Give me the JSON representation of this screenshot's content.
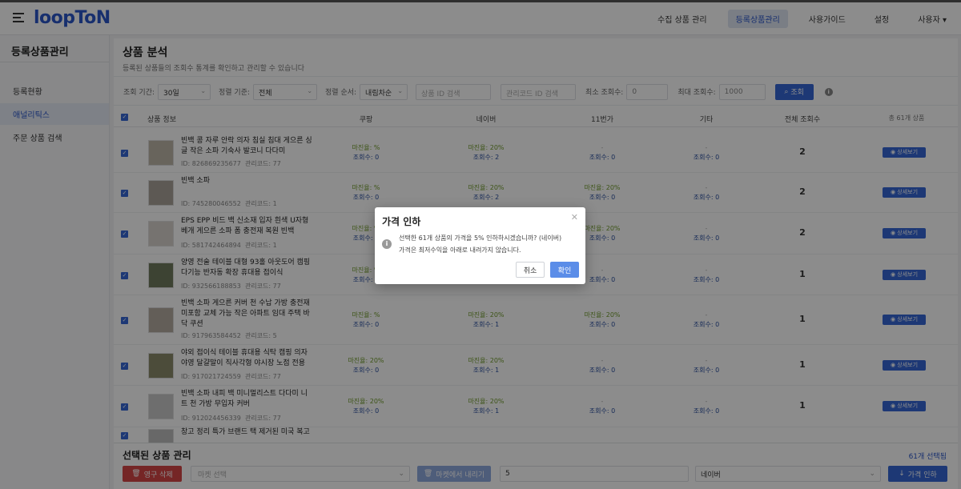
{
  "topbar": {
    "logo": "loopToN",
    "nav": [
      "수집 상품 관리",
      "등록상품관리",
      "사용가이드",
      "설정",
      "사용자 ▾"
    ]
  },
  "sidebar": {
    "title": "등록상품관리",
    "items": [
      "등록현황",
      "애널리틱스",
      "주문 상품 검색"
    ]
  },
  "header": {
    "title": "상품 분석",
    "subtitle": "등록된 상품들의 조회수 통계를 확인하고 관리할 수 있습니다"
  },
  "filters": {
    "period_label": "조회 기간:",
    "period_value": "30일",
    "sort_base_label": "정렬 기준:",
    "sort_base_value": "전체",
    "sort_order_label": "정렬 순서:",
    "sort_order_value": "내림차순",
    "product_id_placeholder": "상품 ID 검색",
    "manage_code_placeholder": "관리코드 ID 검색",
    "min_views_label": "최소 조회수:",
    "min_views_value": "0",
    "max_views_label": "최대 조회수:",
    "max_views_value": "1000",
    "search_label": "조회"
  },
  "table": {
    "headers": [
      "상품 정보",
      "쿠팡",
      "네이버",
      "11번가",
      "기타",
      "전체 조회수",
      "총 61개 상품"
    ],
    "rows": [
      {
        "name": "빈백 콩 자루 안락 의자 침실 침대 게으른 싱글 작은 소파 기숙사 발코니 다다미",
        "id": "ID: 826869235677",
        "code": "관리코드: 77",
        "coupang": {
          "margin": "마진율: %",
          "views": "조회수: 0"
        },
        "naver": {
          "margin": "마진율: 20%",
          "views": "조회수: 2"
        },
        "st11": {
          "margin": "-",
          "views": "조회수: 0"
        },
        "etc": {
          "margin": "-",
          "views": "조회수: 0"
        },
        "total": "2",
        "detail": "상세보기"
      },
      {
        "name": "빈백 소파",
        "id": "ID: 745280046552",
        "code": "관리코드: 1",
        "coupang": {
          "margin": "마진율: %",
          "views": "조회수: 0"
        },
        "naver": {
          "margin": "마진율: 20%",
          "views": "조회수: 2"
        },
        "st11": {
          "margin": "마진율: 20%",
          "views": "조회수: 0"
        },
        "etc": {
          "margin": "-",
          "views": "조회수: 0"
        },
        "total": "2",
        "detail": "상세보기"
      },
      {
        "name": "EPS EPP 비드 백 신소재 입자 흰색 U자형 베개 게으른 소파 폼 충전재 복원 빈백",
        "id": "ID: 581742464894",
        "code": "관리코드: 1",
        "coupang": {
          "margin": "마진율: %",
          "views": "조회수: 0"
        },
        "naver": {
          "margin": "마진율: 20%",
          "views": "조회수: 2"
        },
        "st11": {
          "margin": "마진율: 20%",
          "views": "조회수: 0"
        },
        "etc": {
          "margin": "-",
          "views": "조회수: 0"
        },
        "total": "2",
        "detail": "상세보기"
      },
      {
        "name": "양영 전술 테이블 대형 93홀 아웃도어 캠핑 다기능 반자동 확장 휴대용 접이식",
        "id": "ID: 932566188853",
        "code": "관리코드: 77",
        "coupang": {
          "margin": "마진율: %",
          "views": "조회수: 0"
        },
        "naver": {
          "margin": "마진율: 20%",
          "views": "조회수: 1"
        },
        "st11": {
          "margin": "-",
          "views": "조회수: 0"
        },
        "etc": {
          "margin": "-",
          "views": "조회수: 0"
        },
        "total": "1",
        "detail": "상세보기"
      },
      {
        "name": "빈백 소파 게으른 커버 천 수납 가방 충전재 미포함 교체 가능 작은 아파트 임대 주택 바닥 쿠션",
        "id": "ID: 917963584452",
        "code": "관리코드: 5",
        "coupang": {
          "margin": "마진율: %",
          "views": "조회수: 0"
        },
        "naver": {
          "margin": "마진율: 20%",
          "views": "조회수: 1"
        },
        "st11": {
          "margin": "마진율: 20%",
          "views": "조회수: 0"
        },
        "etc": {
          "margin": "-",
          "views": "조회수: 0"
        },
        "total": "1",
        "detail": "상세보기"
      },
      {
        "name": "야외 접이식 테이블 휴대용 식탁 캠핑 의자 야영 달걀말이 직사각형 야시장 노점 전용",
        "id": "ID: 917021724559",
        "code": "관리코드: 77",
        "coupang": {
          "margin": "마진율: 20%",
          "views": "조회수: 0"
        },
        "naver": {
          "margin": "마진율: 20%",
          "views": "조회수: 1"
        },
        "st11": {
          "margin": "-",
          "views": "조회수: 0"
        },
        "etc": {
          "margin": "-",
          "views": "조회수: 0"
        },
        "total": "1",
        "detail": "상세보기"
      },
      {
        "name": "빈백 소파 내피 백 미니멀리스트 다다미 니트 천 가방 무입자 커버",
        "id": "ID: 912024456339",
        "code": "관리코드: 77",
        "coupang": {
          "margin": "마진율: 20%",
          "views": "조회수: 0"
        },
        "naver": {
          "margin": "마진율: 20%",
          "views": "조회수: 1"
        },
        "st11": {
          "margin": "-",
          "views": "조회수: 0"
        },
        "etc": {
          "margin": "-",
          "views": "조회수: 0"
        },
        "total": "1",
        "detail": "상세보기"
      },
      {
        "name": "창고 정리 특가 브랜드 택 제거된 미국 복고"
      }
    ]
  },
  "bottom": {
    "title": "선택된 상품 관리",
    "count": "61개 선택됨",
    "delete_label": "영구 삭제",
    "market_placeholder": "마켓 선택",
    "market_delete_label": "마켓에서 내리기",
    "percent_value": "5",
    "market_value": "네이버",
    "price_cut_label": "가격 인하"
  },
  "modal": {
    "title": "가격 인하",
    "line1": "선택한 61개 상품의 가격을 5% 인하하시겠습니까? (네이버)",
    "line2": "가격은 최저수익을 아래로 내려가지 않습니다.",
    "cancel": "취소",
    "confirm": "확인"
  },
  "colors": {
    "accent": "#3567d6",
    "margin": "#6f9a2a",
    "views": "#2b4f9e",
    "danger": "#d64545"
  }
}
